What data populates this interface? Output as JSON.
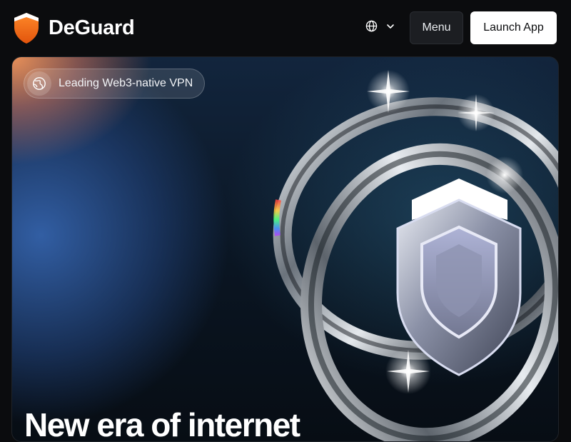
{
  "brand": {
    "name": "DeGuard",
    "logo_icon": "shield-icon",
    "accent": "#f26a1b"
  },
  "header": {
    "language_icon": "globe-icon",
    "menu_label": "Menu",
    "launch_label": "Launch App"
  },
  "hero": {
    "badge_text": "Leading Web3-native VPN",
    "badge_icon": "globe-icon",
    "headline": "New era of internet",
    "illustration": "shield-with-chrome-rings"
  }
}
